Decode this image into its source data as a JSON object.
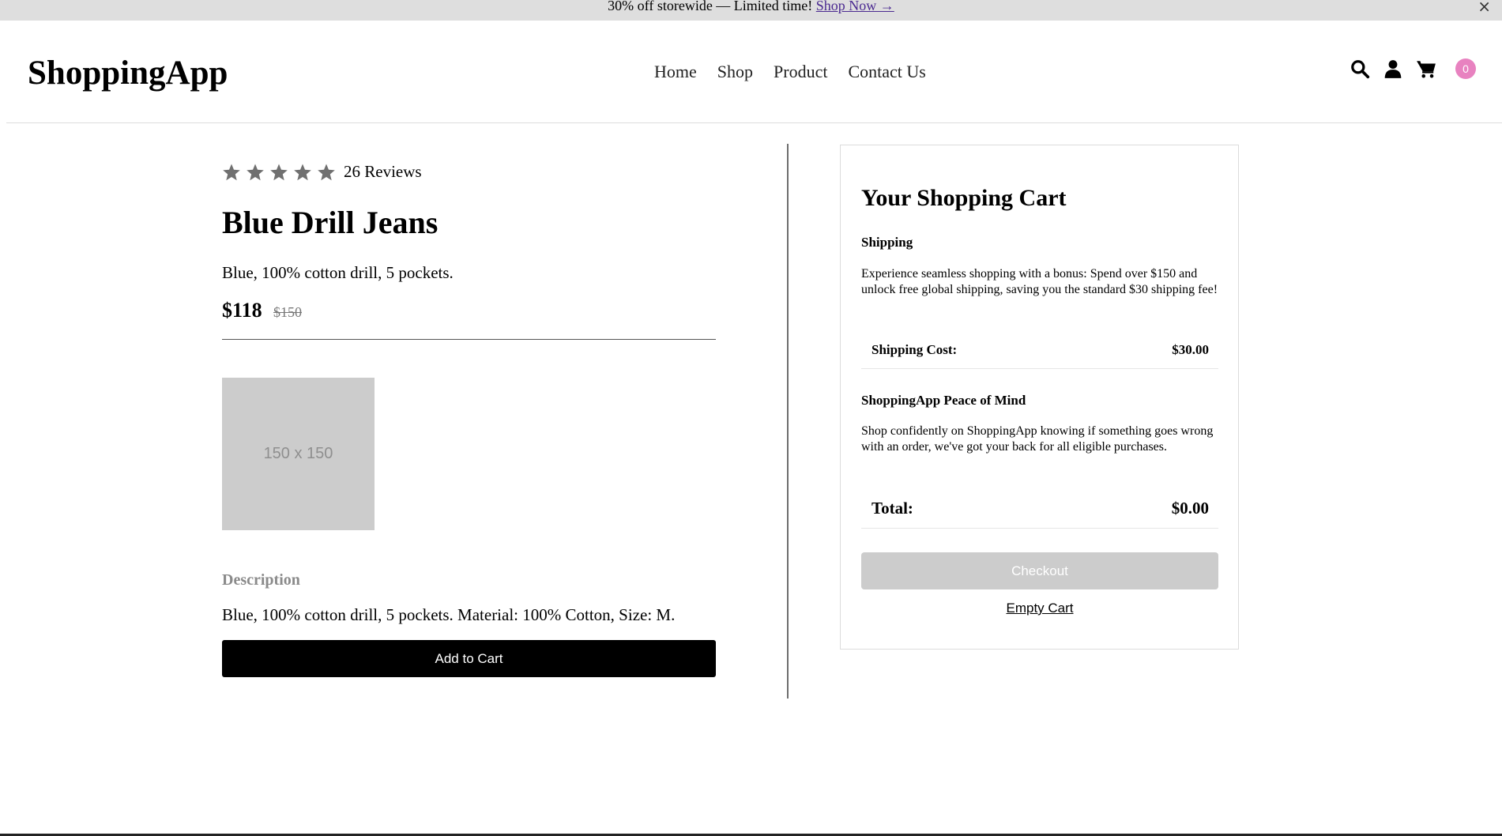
{
  "promo": {
    "text": "30% off storewide — Limited time!",
    "link": "Shop Now →",
    "close": "×"
  },
  "header": {
    "logo": "ShoppingApp",
    "nav": [
      "Home",
      "Shop",
      "Product",
      "Contact Us"
    ],
    "cart_count": "0",
    "badge_color": "#e882c0"
  },
  "product": {
    "rating": 5,
    "reviews": "26 Reviews",
    "title": "Blue Drill Jeans",
    "short_description": "Blue, 100% cotton drill, 5 pockets.",
    "price": "$118",
    "old_price": "$150",
    "image_placeholder": "150 x 150",
    "description_heading": "Description",
    "description": "Blue, 100% cotton drill, 5 pockets. Material: 100% Cotton, Size: M.",
    "add_to_cart": "Add to Cart"
  },
  "cart": {
    "title": "Your Shopping Cart",
    "shipping_heading": "Shipping",
    "shipping_text": "Experience seamless shopping with a bonus: Spend over $150 and unlock free global shipping, saving you the standard $30 shipping fee!",
    "shipping_cost_label": "Shipping Cost:",
    "shipping_cost_value": "$30.00",
    "peace_heading": "ShoppingApp Peace of Mind",
    "peace_text": "Shop confidently on ShoppingApp knowing if something goes wrong with an order, we've got your back for all eligible purchases.",
    "total_label": "Total:",
    "total_value": "$0.00",
    "checkout": "Checkout",
    "empty_cart": "Empty Cart"
  },
  "icons": [
    "search-icon",
    "user-icon",
    "cart-icon",
    "star-icon"
  ]
}
